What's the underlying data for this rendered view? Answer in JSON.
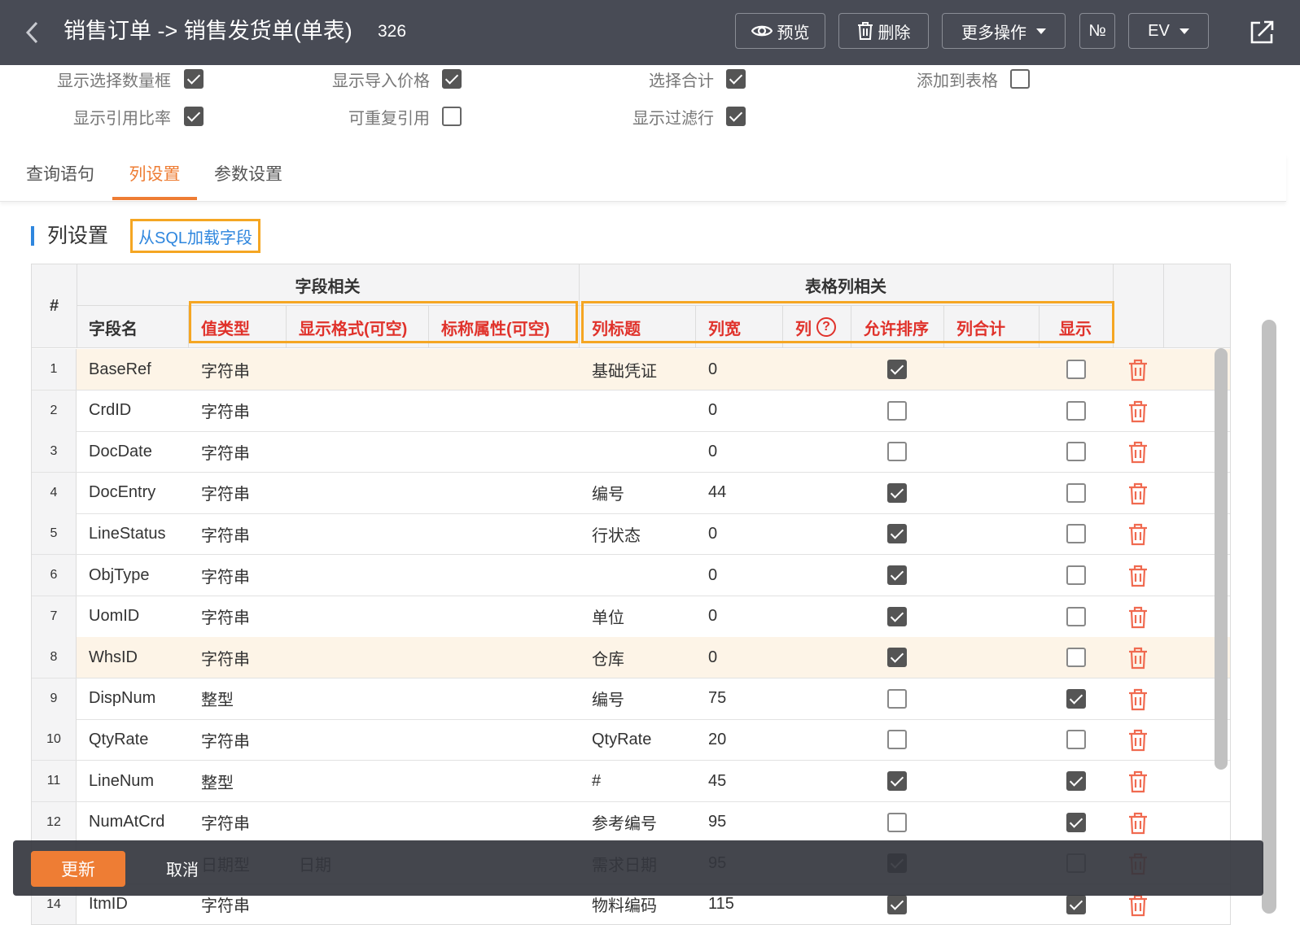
{
  "header": {
    "title": "销售订单 -> 销售发货单(单表)",
    "count": "326",
    "preview_label": "预览",
    "delete_label": "删除",
    "more_label": "更多操作",
    "numbering_label": "№",
    "ev_label": "EV",
    "bg_color": "#484b55"
  },
  "options": [
    {
      "label": "显示选择数量框",
      "checked": true
    },
    {
      "label": "显示导入价格",
      "checked": true
    },
    {
      "label": "选择合计",
      "checked": true
    },
    {
      "label": "添加到表格",
      "checked": false
    },
    {
      "label": "显示引用比率",
      "checked": true
    },
    {
      "label": "可重复引用",
      "checked": false
    },
    {
      "label": "显示过滤行",
      "checked": true
    }
  ],
  "tabs": [
    {
      "label": "查询语句",
      "active": false
    },
    {
      "label": "列设置",
      "active": true
    },
    {
      "label": "参数设置",
      "active": false
    }
  ],
  "section": {
    "title": "列设置",
    "load_sql_label": "从SQL加载字段"
  },
  "grid": {
    "index_header": "#",
    "group_field": "字段相关",
    "group_table": "表格列相关",
    "columns": {
      "field_name": "字段名",
      "value_type": "值类型",
      "display_format": "显示格式(可空)",
      "label_prop": "标称属性(可空)",
      "col_title": "列标题",
      "col_width": "列宽",
      "col": "列",
      "col_help": "?",
      "allow_sort": "允许排序",
      "col_total": "列合计",
      "show": "显示"
    },
    "rows": [
      {
        "no": "1",
        "field": "BaseRef",
        "type": "字符串",
        "format": "",
        "label_prop": "",
        "title": "基础凭证",
        "width": "0",
        "sort": true,
        "show": false,
        "highlight": true
      },
      {
        "no": "2",
        "field": "CrdID",
        "type": "字符串",
        "format": "",
        "label_prop": "",
        "title": "",
        "width": "0",
        "sort": false,
        "show": false,
        "highlight": false
      },
      {
        "no": "3",
        "field": "DocDate",
        "type": "字符串",
        "format": "",
        "label_prop": "",
        "title": "",
        "width": "0",
        "sort": false,
        "show": false,
        "highlight": false
      },
      {
        "no": "4",
        "field": "DocEntry",
        "type": "字符串",
        "format": "",
        "label_prop": "",
        "title": "编号",
        "width": "44",
        "sort": true,
        "show": false,
        "highlight": false
      },
      {
        "no": "5",
        "field": "LineStatus",
        "type": "字符串",
        "format": "",
        "label_prop": "",
        "title": "行状态",
        "width": "0",
        "sort": true,
        "show": false,
        "highlight": false
      },
      {
        "no": "6",
        "field": "ObjType",
        "type": "字符串",
        "format": "",
        "label_prop": "",
        "title": "",
        "width": "0",
        "sort": true,
        "show": false,
        "highlight": false
      },
      {
        "no": "7",
        "field": "UomID",
        "type": "字符串",
        "format": "",
        "label_prop": "",
        "title": "单位",
        "width": "0",
        "sort": true,
        "show": false,
        "highlight": false
      },
      {
        "no": "8",
        "field": "WhsID",
        "type": "字符串",
        "format": "",
        "label_prop": "",
        "title": "仓库",
        "width": "0",
        "sort": true,
        "show": false,
        "highlight": true
      },
      {
        "no": "9",
        "field": "DispNum",
        "type": "整型",
        "format": "",
        "label_prop": "",
        "title": "编号",
        "width": "75",
        "sort": false,
        "show": true,
        "highlight": false
      },
      {
        "no": "10",
        "field": "QtyRate",
        "type": "字符串",
        "format": "",
        "label_prop": "",
        "title": "QtyRate",
        "width": "20",
        "sort": false,
        "show": false,
        "highlight": false
      },
      {
        "no": "11",
        "field": "LineNum",
        "type": "整型",
        "format": "",
        "label_prop": "",
        "title": "#",
        "width": "45",
        "sort": true,
        "show": true,
        "highlight": false
      },
      {
        "no": "12",
        "field": "NumAtCrd",
        "type": "字符串",
        "format": "",
        "label_prop": "",
        "title": "参考编号",
        "width": "95",
        "sort": false,
        "show": true,
        "highlight": false
      },
      {
        "no": "13",
        "field": "Date",
        "type": "日期型",
        "format": "日期",
        "label_prop": "",
        "title": "需求日期",
        "width": "95",
        "sort": true,
        "show": false,
        "highlight": false
      },
      {
        "no": "14",
        "field": "ItmID",
        "type": "字符串",
        "format": "",
        "label_prop": "",
        "title": "物料编码",
        "width": "115",
        "sort": true,
        "show": true,
        "highlight": false
      }
    ]
  },
  "footer": {
    "update_label": "更新",
    "cancel_label": "取消"
  },
  "colors": {
    "accent_orange": "#ee7d34",
    "highlight_box": "#f5a623",
    "header_red": "#e0322b",
    "link_blue": "#2e86de",
    "row_highlight": "#fdf4e7"
  }
}
